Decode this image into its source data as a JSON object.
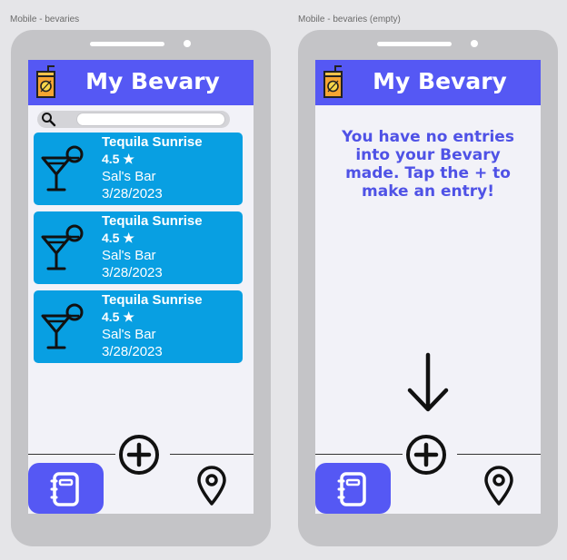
{
  "frames": [
    {
      "label": "Mobile - bevaries",
      "header": {
        "title": "My Bevary",
        "icon": "juice-box-icon"
      },
      "search": {
        "placeholder": "",
        "value": ""
      },
      "entries": [
        {
          "name": "Tequila Sunrise",
          "rating": "4.5",
          "place": "Sal's Bar",
          "date": "3/28/2023",
          "icon": "cocktail-icon"
        },
        {
          "name": "Tequila Sunrise",
          "rating": "4.5",
          "place": "Sal's Bar",
          "date": "3/28/2023",
          "icon": "cocktail-icon"
        },
        {
          "name": "Tequila Sunrise",
          "rating": "4.5",
          "place": "Sal's Bar",
          "date": "3/28/2023",
          "icon": "cocktail-icon"
        }
      ],
      "nav": {
        "left_icon": "journal-icon",
        "center_icon": "plus-circle-icon",
        "right_icon": "map-pin-icon"
      }
    },
    {
      "label": "Mobile - bevaries (empty)",
      "header": {
        "title": "My Bevary",
        "icon": "juice-box-icon"
      },
      "empty_message": "You have no entries into your Bevary made. Tap the + to make an entry!",
      "nav": {
        "left_icon": "journal-icon",
        "center_icon": "plus-circle-icon",
        "right_icon": "map-pin-icon"
      }
    }
  ],
  "colors": {
    "background": "#e5e5e8",
    "phone_body": "#c4c4c7",
    "screen": "#f2f2f8",
    "brand": "#5558f4",
    "card": "#089fe2",
    "message_text": "#4f52e6"
  }
}
